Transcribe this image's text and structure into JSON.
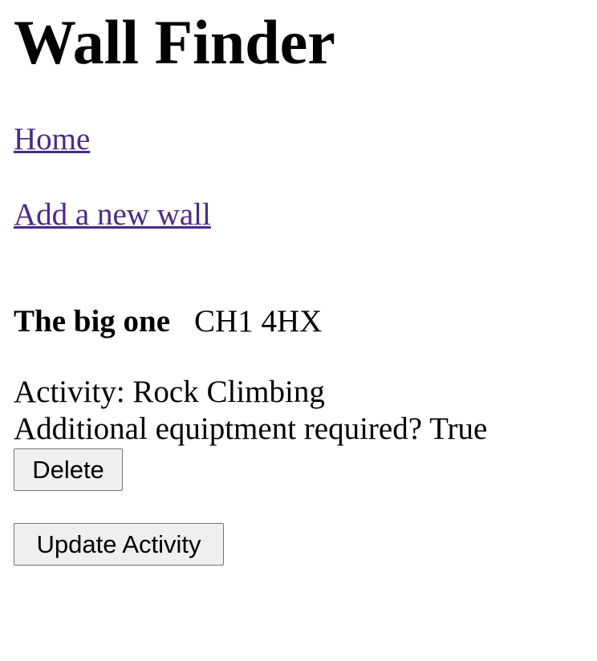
{
  "header": {
    "title": "Wall Finder"
  },
  "nav": {
    "home_label": "Home",
    "add_wall_label": "Add a new wall"
  },
  "wall": {
    "name": "The big one",
    "postcode": "CH1 4HX",
    "activity_text": "Activity: Rock Climbing",
    "equipment_text": "Additional equiptment required? True"
  },
  "actions": {
    "delete_label": "Delete",
    "update_label": "Update Activity"
  },
  "colors": {
    "link": "#4b2a8a",
    "button_bg": "#efefef",
    "button_border": "#767676"
  }
}
